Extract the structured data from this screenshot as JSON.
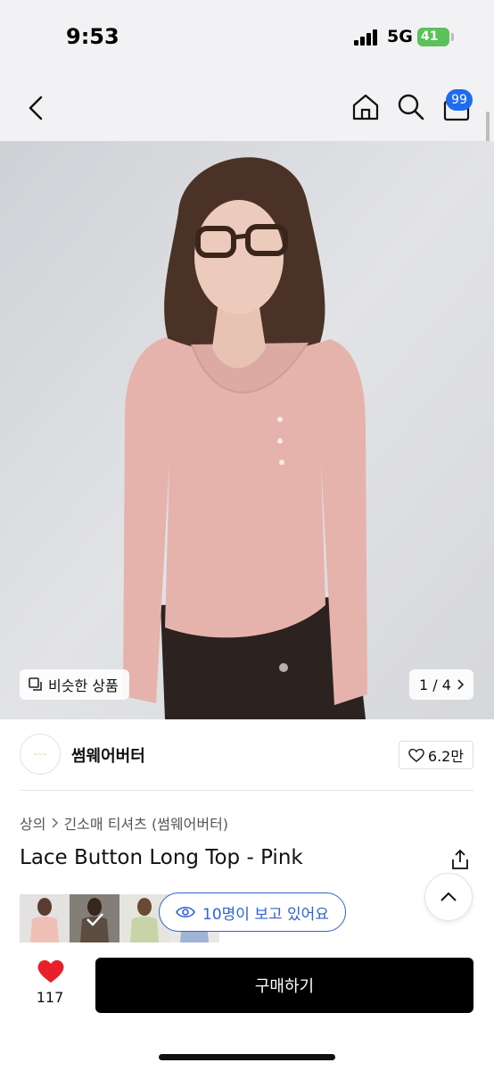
{
  "status_bar": {
    "time": "9:53",
    "network": "5G",
    "battery": "41"
  },
  "header": {
    "cart_count": "99",
    "icons": [
      "back-icon",
      "home-icon",
      "search-icon",
      "cart-icon"
    ]
  },
  "gallery": {
    "similar_label": "비슷한 상품",
    "pager": "1 / 4",
    "current_page": 1,
    "total_pages": 4
  },
  "brand": {
    "name": "썸웨어버터",
    "likes": "6.2만"
  },
  "breadcrumb": {
    "level1": "상의",
    "level2": "긴소매 티셔츠 (썸웨어버터)"
  },
  "product": {
    "title": "Lace Button Long Top - Pink"
  },
  "viewers": {
    "label": "10명이 보고 있어요"
  },
  "bottom_bar": {
    "wish_count": "117",
    "buy_label": "구매하기"
  },
  "colors": {
    "accent_blue": "#2e62d9",
    "badge_blue": "#1f6cf0",
    "heart_red": "#e8202a",
    "buy_bg": "#000000"
  }
}
